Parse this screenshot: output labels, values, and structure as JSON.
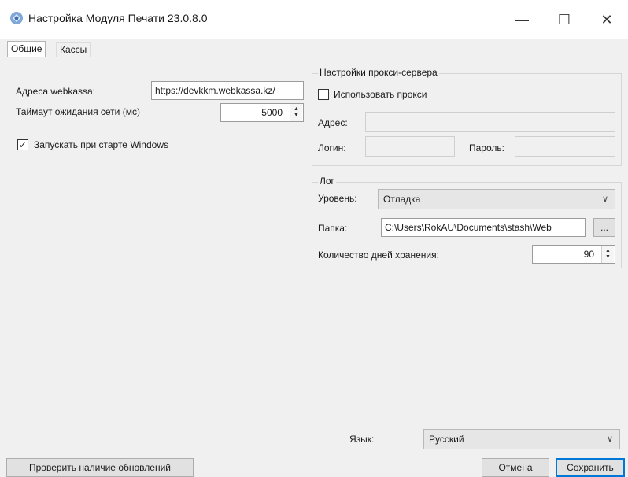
{
  "window": {
    "title": "Настройка Модуля Печати 23.0.8.0",
    "minimize_glyph": "—",
    "maximize_glyph": "☐",
    "close_glyph": "✕"
  },
  "tabs": [
    {
      "label": "Общие",
      "active": true
    },
    {
      "label": "Кассы",
      "active": false
    }
  ],
  "general": {
    "address_label": "Адреса webkassa:",
    "address_value": "https://devkkm.webkassa.kz/",
    "timeout_label": "Таймаут ожидания сети (мс)",
    "timeout_value": "5000",
    "autostart_label": "Запускать при старте Windows",
    "autostart_checked": true
  },
  "proxy": {
    "group_title": "Настройки прокси-сервера",
    "use_proxy_label": "Использовать прокси",
    "use_proxy_checked": false,
    "address_label": "Адрес:",
    "address_value": "",
    "login_label": "Логин:",
    "login_value": "",
    "password_label": "Пароль:",
    "password_value": ""
  },
  "log": {
    "group_title": "Лог",
    "level_label": "Уровень:",
    "level_value": "Отладка",
    "folder_label": "Папка:",
    "folder_value": "C:\\Users\\RokAU\\Documents\\stash\\Web",
    "browse_label": "...",
    "days_label": "Количество дней хранения:",
    "days_value": "90"
  },
  "language": {
    "label": "Язык:",
    "value": "Русский"
  },
  "buttons": {
    "check_updates": "Проверить наличие обновлений",
    "cancel": "Отмена",
    "save": "Сохранить"
  },
  "icons": {
    "app": "printer-icon",
    "dropdown": "chevron-down-icon",
    "spin": "spinner-arrows-icon",
    "check": "checkmark-icon"
  },
  "colors": {
    "accent": "#0078d7",
    "window_bg": "#f0f0f0",
    "titlebar_bg": "#ffffff"
  }
}
